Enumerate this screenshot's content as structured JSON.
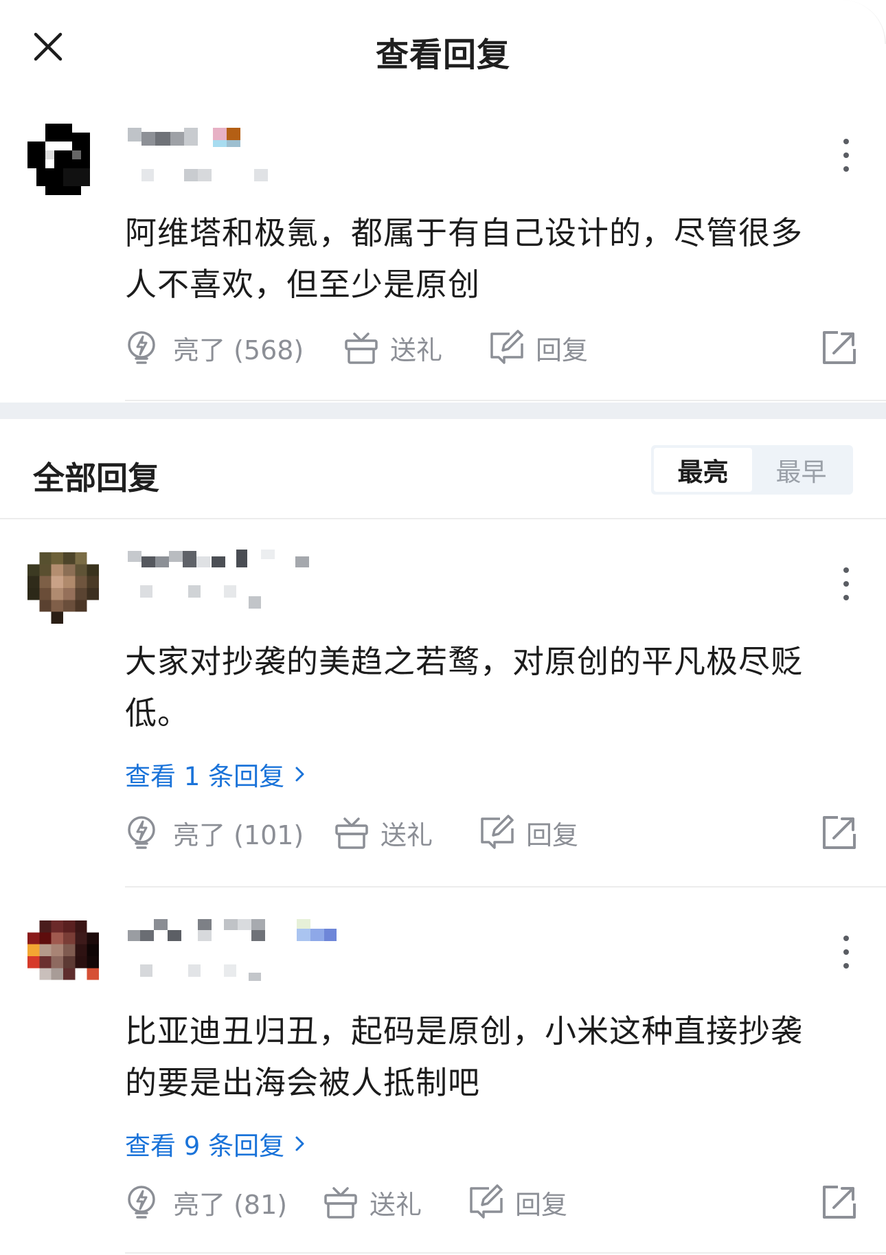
{
  "header": {
    "title": "查看回复"
  },
  "original": {
    "text": "阿维塔和极氪，都属于有自己设计的，尽管很多人不喜欢，但至少是原创",
    "actions": {
      "like": "亮了 (568)",
      "gift": "送礼",
      "reply": "回复"
    }
  },
  "all_replies": {
    "title": "全部回复",
    "sort": {
      "hot": "最亮",
      "early": "最早",
      "selected": "最亮"
    }
  },
  "replies": [
    {
      "text": "大家对抄袭的美趋之若鹜，对原创的平凡极尽贬低。",
      "view_replies": "查看 1 条回复",
      "actions": {
        "like": "亮了 (101)",
        "gift": "送礼",
        "reply": "回复"
      }
    },
    {
      "text": "比亚迪丑归丑，起码是原创，小米这种直接抄袭的要是出海会被人抵制吧",
      "view_replies": "查看 9 条回复",
      "actions": {
        "like": "亮了 (81)",
        "gift": "送礼",
        "reply": "回复"
      }
    }
  ],
  "colors": {
    "link": "#1a73d9",
    "muted": "#8c8f96",
    "text": "#1c1c1c"
  },
  "icons": [
    "close-icon",
    "more-vertical-icon",
    "lightbulb-icon",
    "gift-icon",
    "reply-edit-icon",
    "share-icon",
    "chevron-right-icon"
  ]
}
